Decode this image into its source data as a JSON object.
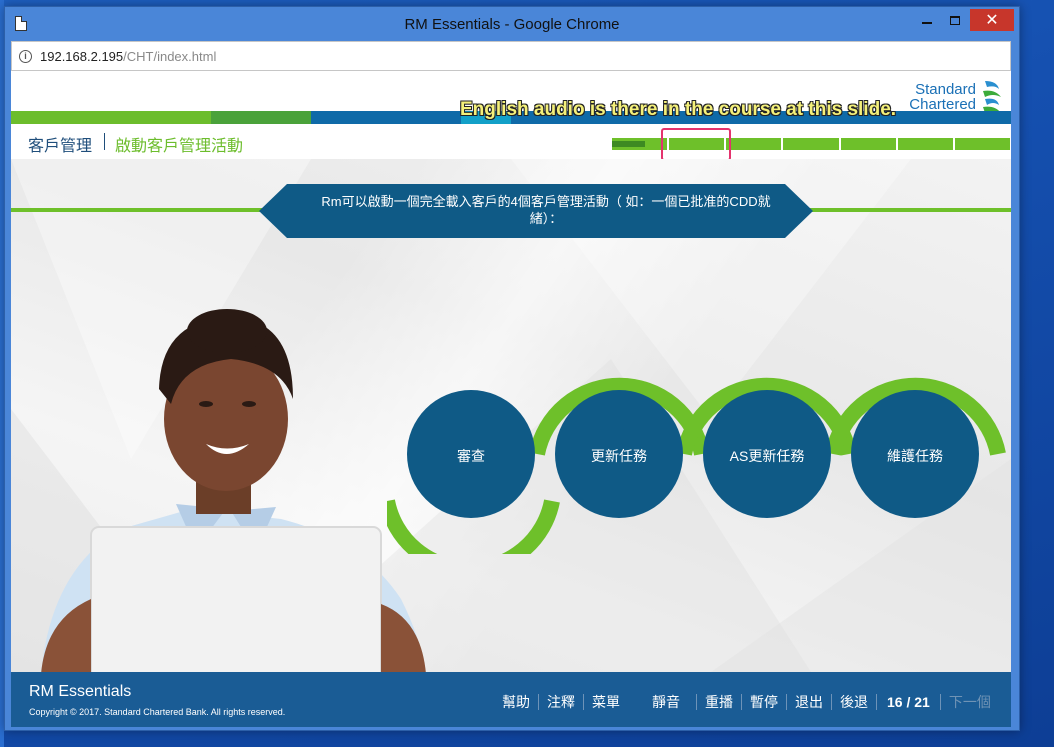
{
  "window": {
    "title": "RM Essentials - Google Chrome",
    "close_label": "✕"
  },
  "address_bar": {
    "host": "192.168.2.195",
    "path": "/CHT/index.html"
  },
  "logo": {
    "line1": "Standard",
    "line2": "Chartered"
  },
  "header": {
    "title": "客戶管理",
    "subtitle": "啟動客戶管理活動"
  },
  "progress": {
    "segments": 7,
    "current_segment": 1,
    "current_fraction": 0.6
  },
  "annotation": {
    "text": "English audio is there in the course at this slide."
  },
  "slide": {
    "banner_text": "Rm可以啟動一個完全載入客戶的4個客戶管理活動（ 如：一個已批准的CDD就緒）：",
    "circles": [
      "審查",
      "更新任務",
      "AS更新任務",
      "維護任務"
    ]
  },
  "footer": {
    "title": "RM Essentials",
    "copyright": "Copyright © 2017. Standard Chartered Bank. All rights reserved.",
    "nav": {
      "help": "幫助",
      "notes": "注釋",
      "menu": "菜單",
      "mute": "靜音",
      "replay": "重播",
      "pause": "暫停",
      "exit": "退出",
      "back": "後退",
      "page": "16 / 21",
      "next": "下一個"
    }
  },
  "colors": {
    "sc_blue": "#1a5c95",
    "sc_green": "#6ec02a",
    "circle_fill": "#0f5a86",
    "banner_fill": "#0f5a86"
  }
}
